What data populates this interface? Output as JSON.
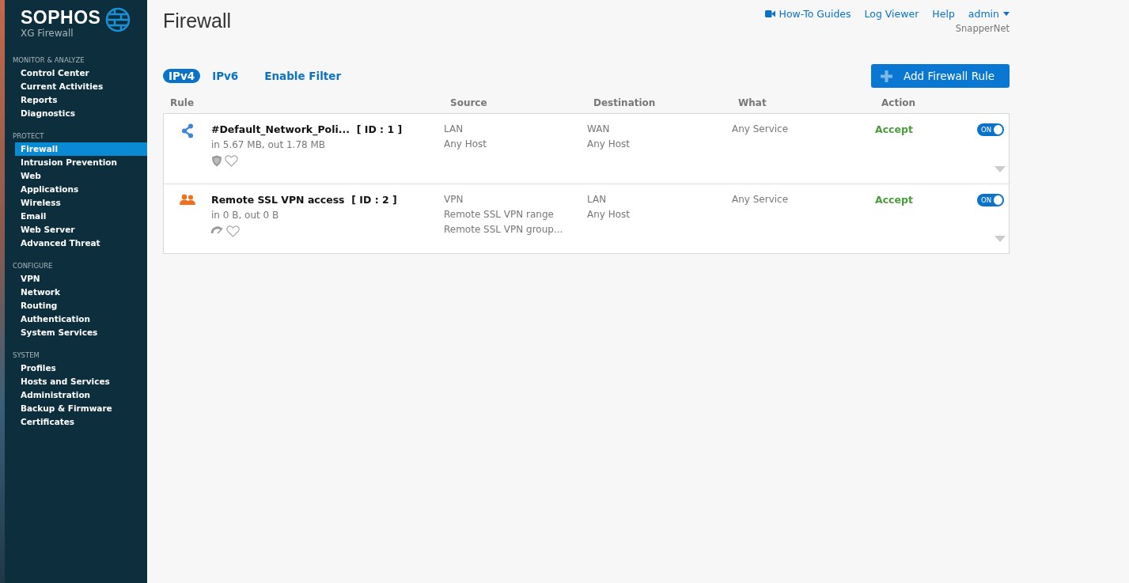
{
  "brand": {
    "name": "SOPHOS",
    "product": "XG Firewall"
  },
  "sidebar": {
    "sections": [
      {
        "heading": "MONITOR & ANALYZE",
        "items": [
          {
            "label": "Control Center",
            "selected": false
          },
          {
            "label": "Current Activities",
            "selected": false
          },
          {
            "label": "Reports",
            "selected": false
          },
          {
            "label": "Diagnostics",
            "selected": false
          }
        ]
      },
      {
        "heading": "PROTECT",
        "items": [
          {
            "label": "Firewall",
            "selected": true
          },
          {
            "label": "Intrusion Prevention",
            "selected": false
          },
          {
            "label": "Web",
            "selected": false
          },
          {
            "label": "Applications",
            "selected": false
          },
          {
            "label": "Wireless",
            "selected": false
          },
          {
            "label": "Email",
            "selected": false
          },
          {
            "label": "Web Server",
            "selected": false
          },
          {
            "label": "Advanced Threat",
            "selected": false
          }
        ]
      },
      {
        "heading": "CONFIGURE",
        "items": [
          {
            "label": "VPN",
            "selected": false
          },
          {
            "label": "Network",
            "selected": false
          },
          {
            "label": "Routing",
            "selected": false
          },
          {
            "label": "Authentication",
            "selected": false
          },
          {
            "label": "System Services",
            "selected": false
          }
        ]
      },
      {
        "heading": "SYSTEM",
        "items": [
          {
            "label": "Profiles",
            "selected": false
          },
          {
            "label": "Hosts and Services",
            "selected": false
          },
          {
            "label": "Administration",
            "selected": false
          },
          {
            "label": "Backup & Firmware",
            "selected": false
          },
          {
            "label": "Certificates",
            "selected": false
          }
        ]
      }
    ]
  },
  "page_title": "Firewall",
  "top_links": {
    "guides": "How-To Guides",
    "log_viewer": "Log Viewer",
    "help": "Help",
    "user": "admin",
    "device": "SnapperNet"
  },
  "tabs": [
    {
      "label": "IPv4",
      "selected": true
    },
    {
      "label": "IPv6",
      "selected": false
    }
  ],
  "filter_link": "Enable Filter",
  "add_button": "Add Firewall Rule",
  "table": {
    "columns": [
      "Rule",
      "Source",
      "Destination",
      "What",
      "Action"
    ],
    "rows": [
      {
        "kind": "network",
        "name": "#Default_Network_Poli...",
        "id": "[ ID : 1 ]",
        "traffic": "in 5.67 MB, out 1.78 MB",
        "source": [
          "LAN",
          "Any Host"
        ],
        "destination": [
          "WAN",
          "Any Host"
        ],
        "what": "Any Service",
        "action": "Accept",
        "on": true,
        "toggle_label": "ON"
      },
      {
        "kind": "user",
        "name": "Remote SSL VPN access",
        "id": "[ ID : 2 ]",
        "traffic": "in 0 B, out 0 B",
        "source": [
          "VPN",
          "Remote SSL VPN range",
          "Remote SSL VPN group..."
        ],
        "destination": [
          "LAN",
          "Any Host"
        ],
        "what": "Any Service",
        "action": "Accept",
        "on": true,
        "toggle_label": "ON"
      }
    ]
  }
}
